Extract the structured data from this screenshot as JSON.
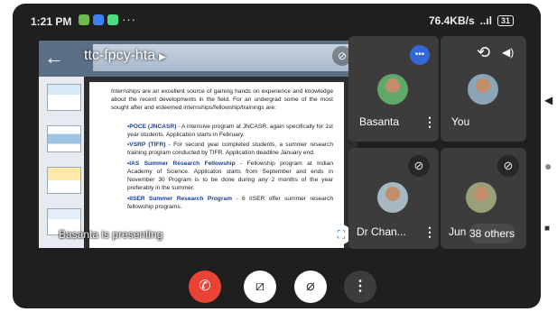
{
  "status_bar": {
    "time": "1:21 PM",
    "more": "···",
    "network_speed": "76.4KB/s",
    "signal": "..ıl",
    "battery": "31"
  },
  "presentation": {
    "title": "ttc-fpcy-hta",
    "chevron": "▶",
    "back_icon": "←",
    "presenting_text": "Basanta is presenting",
    "expand_icon": "⛶",
    "slide": {
      "intro": "Internships are an excellent source of gaining hands on experience and knowledge about the recent developments in the field. For an undergrad some of the most sought after and esteemed internships/fellowship/trainings are:",
      "items": [
        {
          "name": "•POCE (JNCASR)",
          "text": " - A intensive program at JNCASR, again specifically for 1st year students. Application starts in February."
        },
        {
          "name": "•VSRP (TIFR)",
          "text": " - For second year completed students, a summer research training program conducted by TIFR. Application deadline January end."
        },
        {
          "name": "•IAS Summer Research Fellowship",
          "text": " - Fellowship program at Indian Academy of Science. Applicaton starts from September and ends in November 30 Program is to be done during any 2 months of the year preferably in the summer."
        },
        {
          "name": "•IISER Summer Research Program",
          "text": " - 6 IISER offer summer research fellowship programs."
        }
      ]
    }
  },
  "participants": [
    {
      "name": "Basanta"
    },
    {
      "name": "You"
    },
    {
      "name": "Dr Chan..."
    },
    {
      "name": "Jun"
    }
  ],
  "others_label": "38 others",
  "icons": {
    "kebab": "⋮",
    "mic_off": "⊘",
    "camera_switch": "⟲",
    "speaker": "◀)",
    "speaking": "•••",
    "end_call": "✆",
    "cam_off": "⧄",
    "mic_off_btn": "⌀",
    "more": "⋮",
    "nav_back": "◀",
    "nav_home": "●",
    "nav_recents": "■"
  },
  "colors": {
    "end_call": "#ea4335",
    "speaking_badge": "#3367d6",
    "background": "#1f1f1f",
    "tile": "#3c3c3c"
  }
}
